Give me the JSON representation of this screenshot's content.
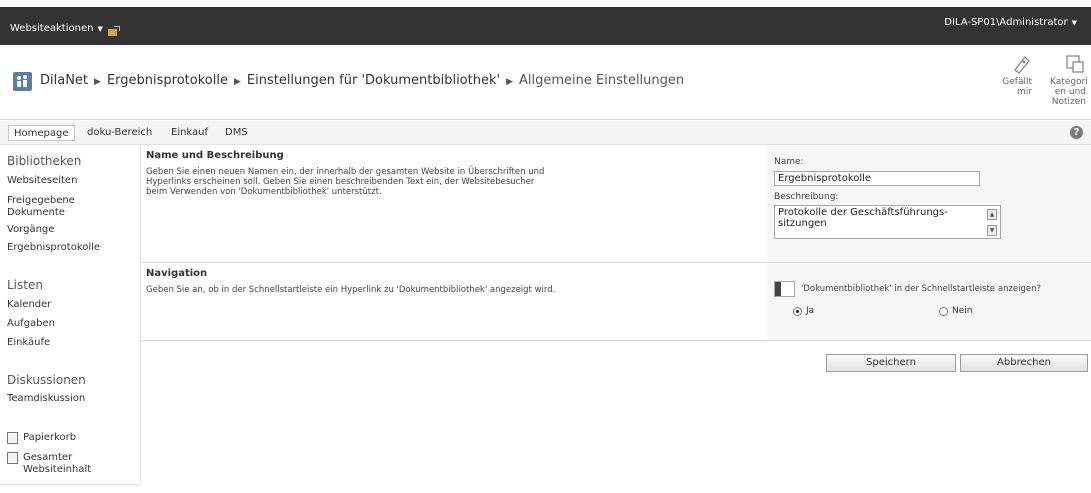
{
  "ribbon": {
    "site_actions": "Websiteaktionen",
    "user": "DILA-SP01\\Administrator"
  },
  "breadcrumb": {
    "items": [
      "DilaNet",
      "Ergebnisprotokolle",
      "Einstellungen für 'Dokumentbibliothek'"
    ],
    "current": "Allgemeine Einstellungen"
  },
  "social": {
    "like": "Gefällt mir",
    "tags": "Kategori en und Notizen"
  },
  "topnav": {
    "tabs": [
      "Homepage",
      "doku-Bereich",
      "Einkauf",
      "DMS"
    ]
  },
  "quicklaunch": {
    "libraries_head": "Bibliotheken",
    "libraries": [
      "Websiteseiten",
      "Freigegebene Dokumente",
      "Vorgänge",
      "Ergebnisprotokolle"
    ],
    "lists_head": "Listen",
    "lists": [
      "Kalender",
      "Aufgaben",
      "Einkäufe"
    ],
    "discussions_head": "Diskussionen",
    "discussions": [
      "Teamdiskussion"
    ],
    "recycle": "Papierkorb",
    "all_content": "Gesamter Websiteinhalt"
  },
  "name_section": {
    "title": "Name und Beschreibung",
    "description": "Geben Sie einen neuen Namen ein, der innerhalb der gesamten Website in Überschriften und Hyperlinks erscheinen soll. Geben Sie einen beschreibenden Text ein, der Websitebesucher beim Verwenden von 'Dokumentbibliothek' unterstützt.",
    "name_label": "Name:",
    "name_value": "Ergebnisprotokolle",
    "desc_label": "Beschreibung:",
    "desc_value": "Protokolle der Geschäftsführungs-sitzungen"
  },
  "nav_section": {
    "title": "Navigation",
    "description": "Geben Sie an, ob in der Schnellstartleiste ein Hyperlink zu 'Dokumentbibliothek' angezeigt wird.",
    "question": "'Dokumentbibliothek' in der Schnellstartleiste anzeigen?",
    "yes": "Ja",
    "no": "Nein"
  },
  "buttons": {
    "save": "Speichern",
    "cancel": "Abbrechen"
  }
}
